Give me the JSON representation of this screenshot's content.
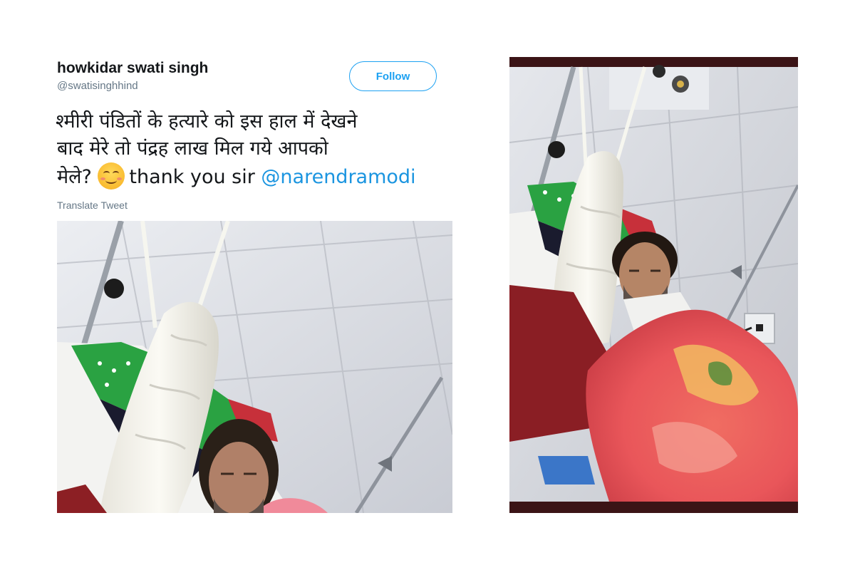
{
  "tweet": {
    "display_name": "howkidar swati singh",
    "handle": "swatisinghhind",
    "follow_label": "Follow",
    "text_line1": "श्मीरी पंडितों के हत्यारे को इस हाल में देखने",
    "text_line2": "बाद मेरे तो  पंद्रह लाख मिल गये आपको",
    "text_line3_prefix": "मेले?",
    "text_line3_after_emoji": "thank you sir",
    "mention": "@narendramodi",
    "translate_label": "Translate Tweet"
  },
  "images": {
    "left_photo": "hospital-patient-arm-cast-photo",
    "right_photo": "hospital-patient-blanket-photo"
  },
  "colors": {
    "accent": "#1da1f2",
    "mention": "#1b95e0",
    "text": "#14171a",
    "secondary": "#657786"
  }
}
